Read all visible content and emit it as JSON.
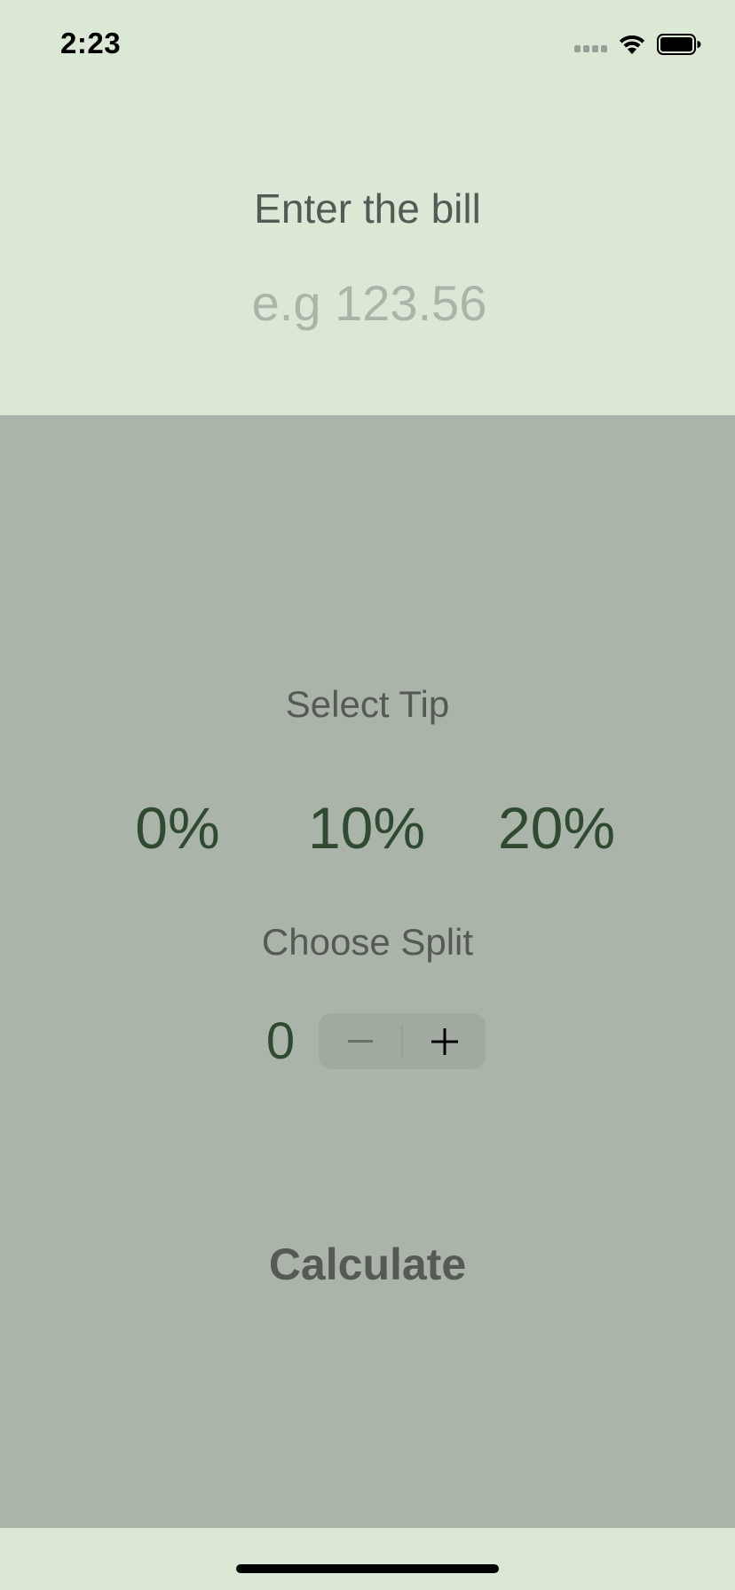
{
  "status_bar": {
    "time": "2:23",
    "icons": [
      "cellular-signal-icon",
      "wifi-icon",
      "battery-icon"
    ]
  },
  "bill": {
    "title": "Enter the bill",
    "input_value": "",
    "placeholder": "e.g 123.56"
  },
  "tip": {
    "label": "Select Tip",
    "options": [
      "0%",
      "10%",
      "20%"
    ]
  },
  "split": {
    "label": "Choose Split",
    "value": "0"
  },
  "calculate_label": "Calculate",
  "colors": {
    "top_background": "#dce8d6",
    "bottom_background": "#aab4a8",
    "accent_green": "#2f4a30",
    "label_gray": "#555a55"
  }
}
